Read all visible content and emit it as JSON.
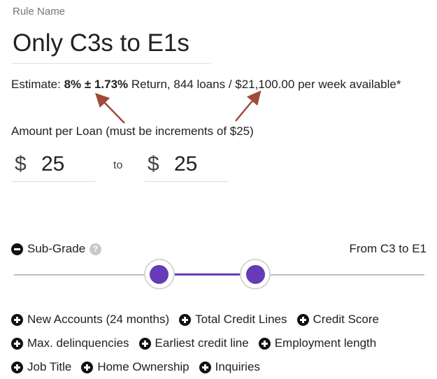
{
  "rule_name": {
    "label": "Rule Name",
    "value": "Only C3s to E1s"
  },
  "estimate": {
    "prefix": "Estimate:",
    "return_value": "8% ± 1.73%",
    "suffix": "Return, 844 loans / $21,100.00 per week available*",
    "arrow_color": "#a04a3a"
  },
  "amount": {
    "label": "Amount per Loan (must be increments of $25)",
    "currency": "$",
    "min_value": "25",
    "max_value": "25",
    "to_label": "to"
  },
  "subgrade": {
    "toggle_icon": "minus-circle-icon",
    "label": "Sub-Grade",
    "help_glyph": "?",
    "range_text": "From C3 to E1",
    "accent_color": "#673ab7",
    "slider_low_fraction": 0.354,
    "slider_high_fraction": 0.588
  },
  "filters": {
    "rows": [
      [
        "New Accounts (24 months)",
        "Total Credit Lines",
        "Credit Score"
      ],
      [
        "Max. delinquencies",
        "Earliest credit line",
        "Employment length"
      ],
      [
        "Job Title",
        "Home Ownership",
        "Inquiries"
      ]
    ]
  }
}
